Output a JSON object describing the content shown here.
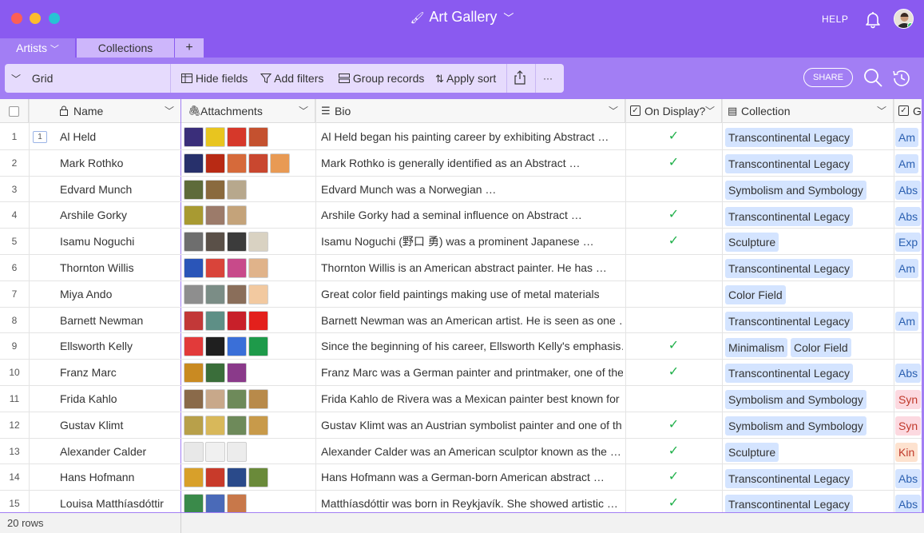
{
  "window": {
    "title": "Art Gallery",
    "help_label": "HELP"
  },
  "tabs": [
    {
      "label": "Artists",
      "active": true
    },
    {
      "label": "Collections",
      "active": false
    },
    {
      "label": "+"
    }
  ],
  "toolbar": {
    "view_label": "Grid",
    "hide_fields": "Hide fields",
    "add_filters": "Add filters",
    "group_records": "Group records",
    "apply_sort": "Apply sort",
    "more": "···",
    "share_label": "SHARE"
  },
  "columns": {
    "name": "Name",
    "attachments": "Attachments",
    "bio": "Bio",
    "on_display": "On Display?",
    "collection": "Collection",
    "genre_cut": "G"
  },
  "colors": {
    "accent": "#8a5af0",
    "toolbar": "#a27ef4",
    "tag_bg": "#d4e4ff",
    "check": "#22b14c"
  },
  "rows": [
    {
      "num": "1",
      "name": "Al Held",
      "comments": "1",
      "bio": "Al Held began his painting career by exhibiting Abstract …",
      "on_display": true,
      "collections": [
        "Transcontinental Legacy"
      ],
      "genre": "Am",
      "genre_color": "#d4e4ff",
      "thumbs": [
        "#3a2e7a",
        "#e8c51f",
        "#d6382a",
        "#c4512f"
      ]
    },
    {
      "num": "2",
      "name": "Mark Rothko",
      "comments": "",
      "bio": "Mark Rothko is generally identified as an Abstract …",
      "on_display": true,
      "collections": [
        "Transcontinental Legacy"
      ],
      "genre": "Am",
      "genre_color": "#d4e4ff",
      "thumbs": [
        "#27306b",
        "#b82a14",
        "#d66a3a",
        "#c9472f",
        "#e89a54"
      ]
    },
    {
      "num": "3",
      "name": "Edvard Munch",
      "comments": "",
      "bio": "Edvard Munch was a Norwegian …",
      "on_display": false,
      "collections": [
        "Symbolism and Symbology"
      ],
      "genre": "Abs",
      "genre_color": "#d4e4ff",
      "thumbs": [
        "#5e6b3a",
        "#8a6a3e",
        "#b7a88d"
      ]
    },
    {
      "num": "4",
      "name": "Arshile Gorky",
      "comments": "",
      "bio": "Arshile Gorky had a seminal influence on Abstract …",
      "on_display": true,
      "collections": [
        "Transcontinental Legacy"
      ],
      "genre": "Abs",
      "genre_color": "#d4e4ff",
      "thumbs": [
        "#a89a32",
        "#9c7b6a",
        "#c4a37a"
      ]
    },
    {
      "num": "5",
      "name": "Isamu Noguchi",
      "comments": "",
      "bio": "Isamu Noguchi (野口 勇) was a prominent Japanese …",
      "on_display": true,
      "collections": [
        "Sculpture"
      ],
      "genre": "Exp",
      "genre_color": "#d4e4ff",
      "thumbs": [
        "#6e6e6e",
        "#5a5048",
        "#3b3b3b",
        "#d9d2c2"
      ]
    },
    {
      "num": "6",
      "name": "Thornton Willis",
      "comments": "",
      "bio": "Thornton Willis is an American abstract painter. He has …",
      "on_display": false,
      "collections": [
        "Transcontinental Legacy"
      ],
      "genre": "Am",
      "genre_color": "#d4e4ff",
      "thumbs": [
        "#2a55b8",
        "#d9443a",
        "#c84a8a",
        "#e0b38a"
      ]
    },
    {
      "num": "7",
      "name": "Miya Ando",
      "comments": "",
      "bio": "Great color field paintings making use of metal materials",
      "on_display": false,
      "collections": [
        "Color Field"
      ],
      "genre": "",
      "genre_color": "#d4e4ff",
      "thumbs": [
        "#8e8e8e",
        "#7b8d86",
        "#8a6e5a",
        "#f2c9a0"
      ]
    },
    {
      "num": "8",
      "name": "Barnett Newman",
      "comments": "",
      "bio": "Barnett Newman was an American artist. He is seen as one …",
      "on_display": false,
      "collections": [
        "Transcontinental Legacy"
      ],
      "genre": "Am",
      "genre_color": "#d4e4ff",
      "thumbs": [
        "#c23838",
        "#5e8f86",
        "#c8202a",
        "#e3201c"
      ]
    },
    {
      "num": "9",
      "name": "Ellsworth Kelly",
      "comments": "",
      "bio": "Since the beginning of his career, Ellsworth Kelly's emphasis…",
      "on_display": true,
      "collections": [
        "Minimalism",
        "Color Field"
      ],
      "genre": "",
      "genre_color": "#d4e4ff",
      "thumbs": [
        "#e23a3a",
        "#1f1f1f",
        "#3a6fd8",
        "#1e9a4a"
      ]
    },
    {
      "num": "10",
      "name": "Franz Marc",
      "comments": "",
      "bio": "Franz Marc was a German painter and printmaker, one of the…",
      "on_display": true,
      "collections": [
        "Transcontinental Legacy"
      ],
      "genre": "Abs",
      "genre_color": "#d4e4ff",
      "thumbs": [
        "#c98a22",
        "#3a6e3a",
        "#8a3a8a"
      ]
    },
    {
      "num": "11",
      "name": "Frida Kahlo",
      "comments": "",
      "bio": "Frida Kahlo de Rivera was a Mexican painter best known for …",
      "on_display": false,
      "collections": [
        "Symbolism and Symbology"
      ],
      "genre": "Syn",
      "genre_color": "#fcd9e0",
      "thumbs": [
        "#8a6a4a",
        "#c8a88a",
        "#6e8a5a",
        "#b88a4a"
      ]
    },
    {
      "num": "12",
      "name": "Gustav Klimt",
      "comments": "",
      "bio": "Gustav Klimt was an Austrian symbolist painter and one of th…",
      "on_display": true,
      "collections": [
        "Symbolism and Symbology"
      ],
      "genre": "Syn",
      "genre_color": "#fcd9e0",
      "thumbs": [
        "#b8a04a",
        "#d8b85a",
        "#6e8a5a",
        "#c89a4a"
      ]
    },
    {
      "num": "13",
      "name": "Alexander Calder",
      "comments": "",
      "bio": "Alexander Calder was an American sculptor known as the …",
      "on_display": true,
      "collections": [
        "Sculpture"
      ],
      "genre": "Kin",
      "genre_color": "#fde2cf",
      "thumbs": [
        "#e8e8e8",
        "#f0f0f0",
        "#ececec"
      ]
    },
    {
      "num": "14",
      "name": "Hans Hofmann",
      "comments": "",
      "bio": "Hans Hofmann was a German-born American abstract …",
      "on_display": true,
      "collections": [
        "Transcontinental Legacy"
      ],
      "genre": "Abs",
      "genre_color": "#d4e4ff",
      "thumbs": [
        "#d8a02a",
        "#c83a2a",
        "#2a4a8a",
        "#6a8a3a"
      ]
    },
    {
      "num": "15",
      "name": "Louisa Matthíasdóttir",
      "comments": "",
      "bio": "Matthíasdóttir was born in Reykjavík. She showed artistic …",
      "on_display": true,
      "collections": [
        "Transcontinental Legacy"
      ],
      "genre": "Abs",
      "genre_color": "#d4e4ff",
      "thumbs": [
        "#3a8a4a",
        "#4a6ab8",
        "#c8784a"
      ]
    }
  ],
  "footer": {
    "row_count": "20 rows"
  }
}
